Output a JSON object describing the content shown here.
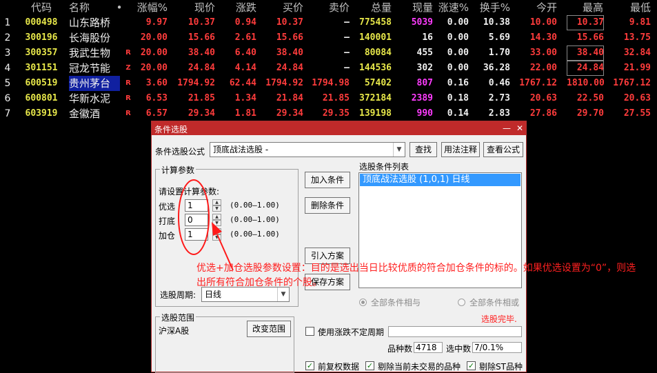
{
  "columns": [
    "",
    "代码",
    "名称",
    "•",
    "涨幅%",
    "现价",
    "涨跌",
    "买价",
    "卖价",
    "总量",
    "现量",
    "涨速%",
    "换手%",
    "今开",
    "最高",
    "最低"
  ],
  "rows": [
    {
      "idx": "1",
      "code": "000498",
      "name": "山东路桥",
      "tag": "",
      "pct": "9.97",
      "price": "10.37",
      "chg": "0.94",
      "bid": "10.37",
      "ask": "—",
      "vol": "775458",
      "cur": "5039",
      "speed": "0.00",
      "turn": "10.38",
      "open": "10.00",
      "high": "10.37",
      "low": "9.81"
    },
    {
      "idx": "2",
      "code": "300196",
      "name": "长海股份",
      "tag": "",
      "pct": "20.00",
      "price": "15.66",
      "chg": "2.61",
      "bid": "15.66",
      "ask": "—",
      "vol": "140001",
      "cur": "16",
      "speed": "0.00",
      "turn": "5.69",
      "open": "14.30",
      "high": "15.66",
      "low": "13.75"
    },
    {
      "idx": "3",
      "code": "300357",
      "name": "我武生物",
      "tag": "R",
      "pct": "20.00",
      "price": "38.40",
      "chg": "6.40",
      "bid": "38.40",
      "ask": "—",
      "vol": "80084",
      "cur": "455",
      "speed": "0.00",
      "turn": "1.70",
      "open": "33.00",
      "high": "38.40",
      "low": "32.84"
    },
    {
      "idx": "4",
      "code": "301151",
      "name": "冠龙节能",
      "tag": "Z",
      "pct": "20.00",
      "price": "24.84",
      "chg": "4.14",
      "bid": "24.84",
      "ask": "—",
      "vol": "144536",
      "cur": "302",
      "speed": "0.00",
      "turn": "36.28",
      "open": "22.00",
      "high": "24.84",
      "low": "21.99"
    },
    {
      "idx": "5",
      "code": "600519",
      "name": "贵州茅台",
      "tag": "R",
      "pct": "3.60",
      "price": "1794.92",
      "chg": "62.44",
      "bid": "1794.92",
      "ask": "1794.98",
      "vol": "57402",
      "cur": "807",
      "speed": "0.16",
      "turn": "0.46",
      "open": "1767.12",
      "high": "1810.00",
      "low": "1767.12"
    },
    {
      "idx": "6",
      "code": "600801",
      "name": "华新水泥",
      "tag": "R",
      "pct": "6.53",
      "price": "21.85",
      "chg": "1.34",
      "bid": "21.84",
      "ask": "21.85",
      "vol": "372184",
      "cur": "2389",
      "speed": "0.18",
      "turn": "2.73",
      "open": "20.63",
      "high": "22.50",
      "low": "20.63"
    },
    {
      "idx": "7",
      "code": "603919",
      "name": "金徽酒",
      "tag": "R",
      "pct": "6.57",
      "price": "29.34",
      "chg": "1.81",
      "bid": "29.34",
      "ask": "29.35",
      "vol": "139198",
      "cur": "990",
      "speed": "0.14",
      "turn": "2.83",
      "open": "27.86",
      "high": "29.70",
      "low": "27.55"
    }
  ],
  "dialog": {
    "title": "条件选股",
    "minimize": "—",
    "close": "✕",
    "formula_label": "条件选股公式",
    "formula_value": "顶底战法选股 -",
    "find_button": "查找",
    "usage_button": "用法注释",
    "view_formula_button": "查看公式",
    "calc_group": "计算参数",
    "set_params_label": "请设置计算参数:",
    "params": [
      {
        "label": "优选",
        "value": "1",
        "range": "(0.00—1.00)"
      },
      {
        "label": "打底",
        "value": "0",
        "range": "(0.00—1.00)"
      },
      {
        "label": "加仓",
        "value": "1",
        "range": "(0.00—1.00)"
      }
    ],
    "add_condition": "加入条件",
    "delete_condition": "删除条件",
    "import_plan": "引入方案",
    "save_plan": "保存方案",
    "condition_list_label": "选股条件列表",
    "condition_item": "顶底战法选股 (1,0,1) 日线",
    "period_label": "选股周期:",
    "period_value": "日线",
    "radio_and": "全部条件相与",
    "radio_or": "全部条件相或",
    "status": "选股完毕.",
    "range_group": "选股范围",
    "range_value": "沪深A股",
    "change_range": "改变范围",
    "use_uncertain_cycle": "使用涨跌不定周期",
    "count_label": "品种数",
    "count_value": "4718",
    "selected_label": "选中数",
    "selected_value": "7/0.1%",
    "opt_adjusted": "前复权数据",
    "opt_exclude_untraded": "剔除当前未交易的品种",
    "opt_exclude_st": "剔除ST品种"
  },
  "annotation": "优选+加仓选股参数设置：目的是选出当日比较优质的符合加仓条件的标的。如果优选设置为“0”，则选出所有符合加仓条件的个股。",
  "colors": {
    "up": "#ff3c3c",
    "volume": "#e8e84a",
    "highlight": "#ff3cff",
    "titlebar": "#c02a2a",
    "annotation": "#ff2020"
  }
}
